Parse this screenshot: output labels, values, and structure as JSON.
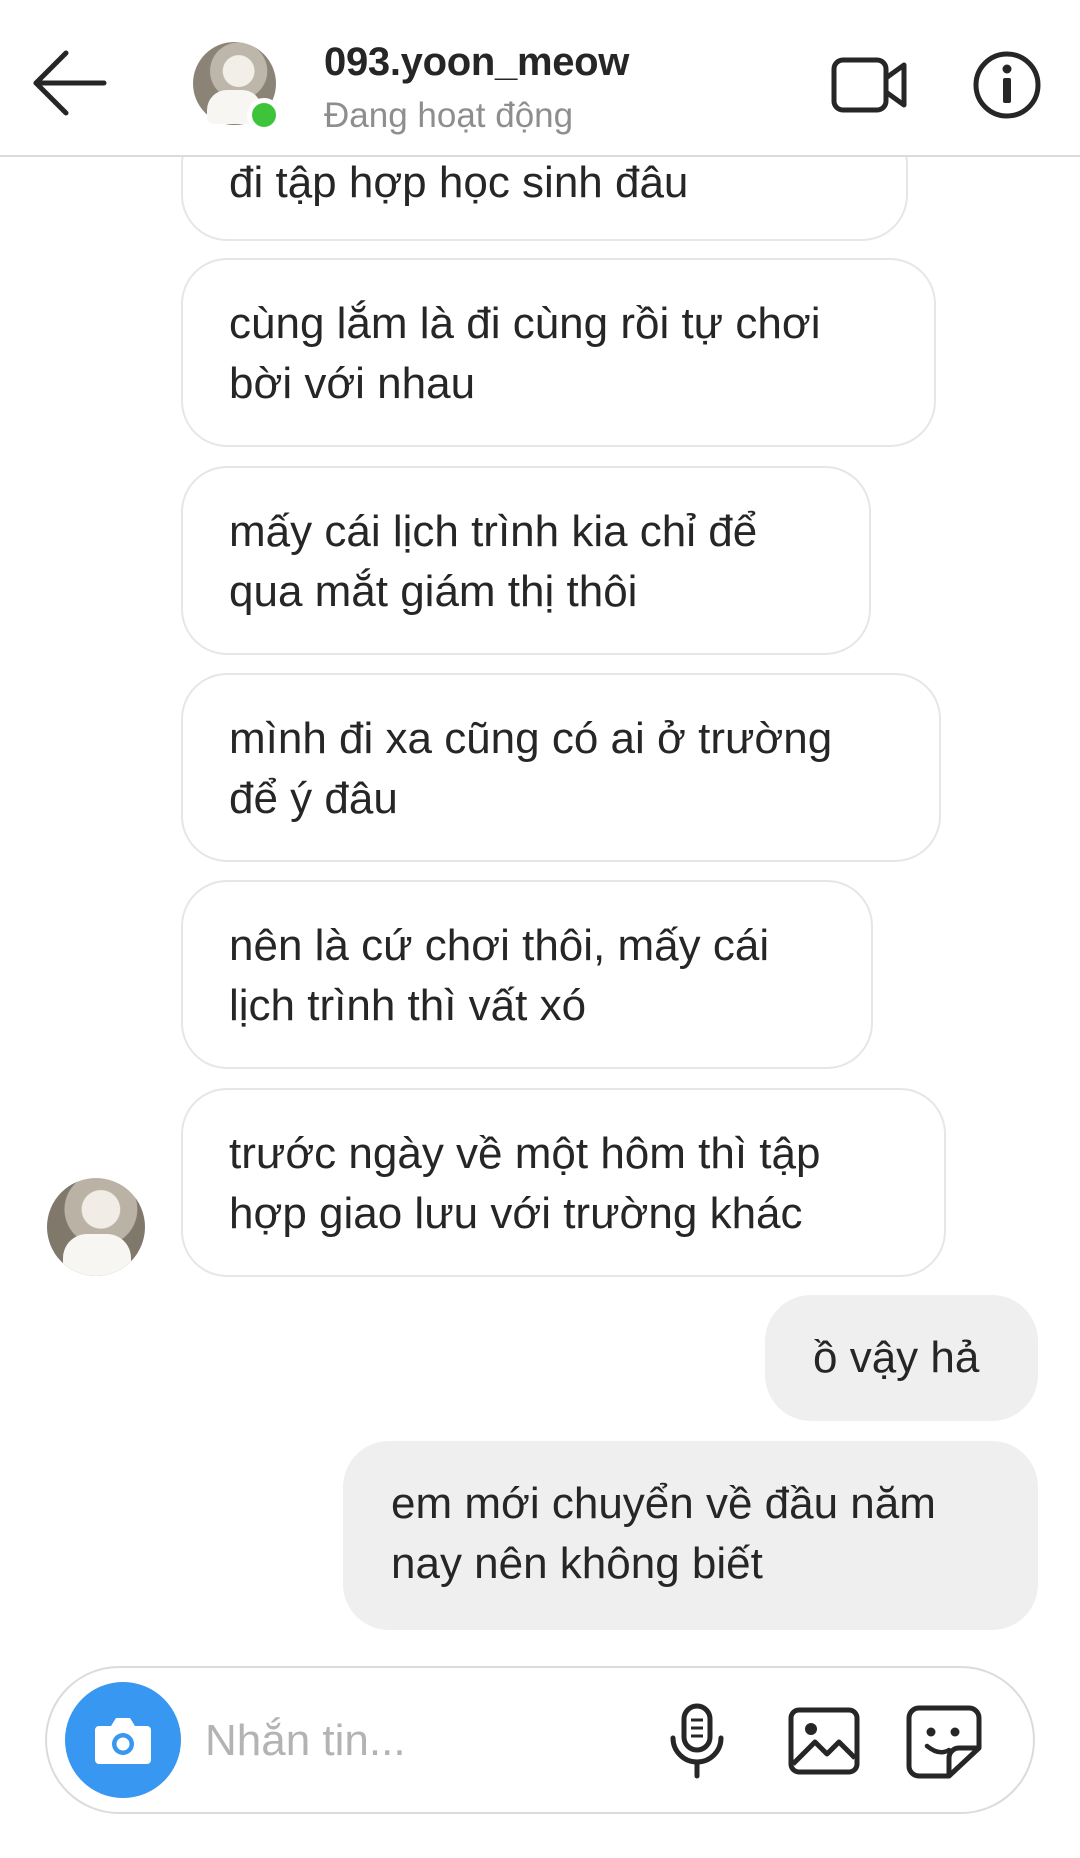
{
  "header": {
    "username": "093.yoon_meow",
    "status": "Đang hoạt động",
    "icons": {
      "back": "arrow-left-icon",
      "video": "video-call-icon",
      "info": "info-icon"
    },
    "online_color": "#3ec43b"
  },
  "messages": [
    {
      "direction": "in",
      "lines": [
        "đi tập hợp học sinh đâu"
      ]
    },
    {
      "direction": "in",
      "lines": [
        "cùng lắm là đi cùng rồi tự chơi",
        "bời với nhau"
      ]
    },
    {
      "direction": "in",
      "lines": [
        "mấy cái lịch trình kia chỉ để",
        "qua mắt giám thị thôi"
      ]
    },
    {
      "direction": "in",
      "lines": [
        "mình đi xa cũng có ai ở trường",
        "để ý đâu"
      ]
    },
    {
      "direction": "in",
      "lines": [
        "nên là cứ chơi thôi, mấy cái",
        "lịch trình thì vất xó"
      ]
    },
    {
      "direction": "in",
      "lines": [
        "trước ngày về một hôm thì tập",
        "hợp giao lưu với trường khác"
      ]
    },
    {
      "direction": "out",
      "lines": [
        "ồ vậy hả"
      ]
    },
    {
      "direction": "out",
      "lines": [
        "em mới chuyển về đầu năm",
        "nay nên không biết"
      ]
    }
  ],
  "composer": {
    "placeholder": "Nhắn tin...",
    "value": "",
    "icons": {
      "camera": "camera-icon",
      "mic": "microphone-icon",
      "gallery": "image-icon",
      "sticker": "sticker-icon"
    },
    "camera_color": "#3897f0"
  },
  "colors": {
    "incoming_border": "#e6e6e6",
    "outgoing_bg": "#efefef",
    "text": "#262626",
    "muted": "#8e8e8e"
  }
}
